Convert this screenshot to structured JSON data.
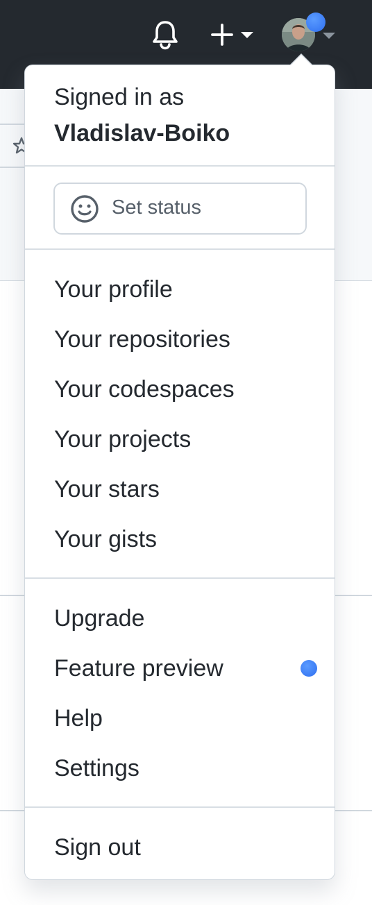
{
  "header": {
    "notifications_icon": "bell-icon",
    "create_icon": "plus-icon",
    "create_caret_icon": "caret-down-icon",
    "avatar_caret_icon": "caret-down-icon",
    "notification_dot_color": "#2f81f7",
    "background_color": "#24292f"
  },
  "dropdown": {
    "signed_in_label": "Signed in as",
    "username": "Vladislav-Boiko",
    "status": {
      "label": "Set status",
      "icon": "smiley-icon"
    },
    "primary_items": [
      {
        "label": "Your profile"
      },
      {
        "label": "Your repositories"
      },
      {
        "label": "Your codespaces"
      },
      {
        "label": "Your projects"
      },
      {
        "label": "Your stars"
      },
      {
        "label": "Your gists"
      }
    ],
    "secondary_items": [
      {
        "label": "Upgrade"
      },
      {
        "label": "Feature preview"
      },
      {
        "label": "Help"
      },
      {
        "label": "Settings"
      }
    ],
    "sign_out_label": "Sign out",
    "feature_preview_dot_color": "#2f81f7"
  }
}
